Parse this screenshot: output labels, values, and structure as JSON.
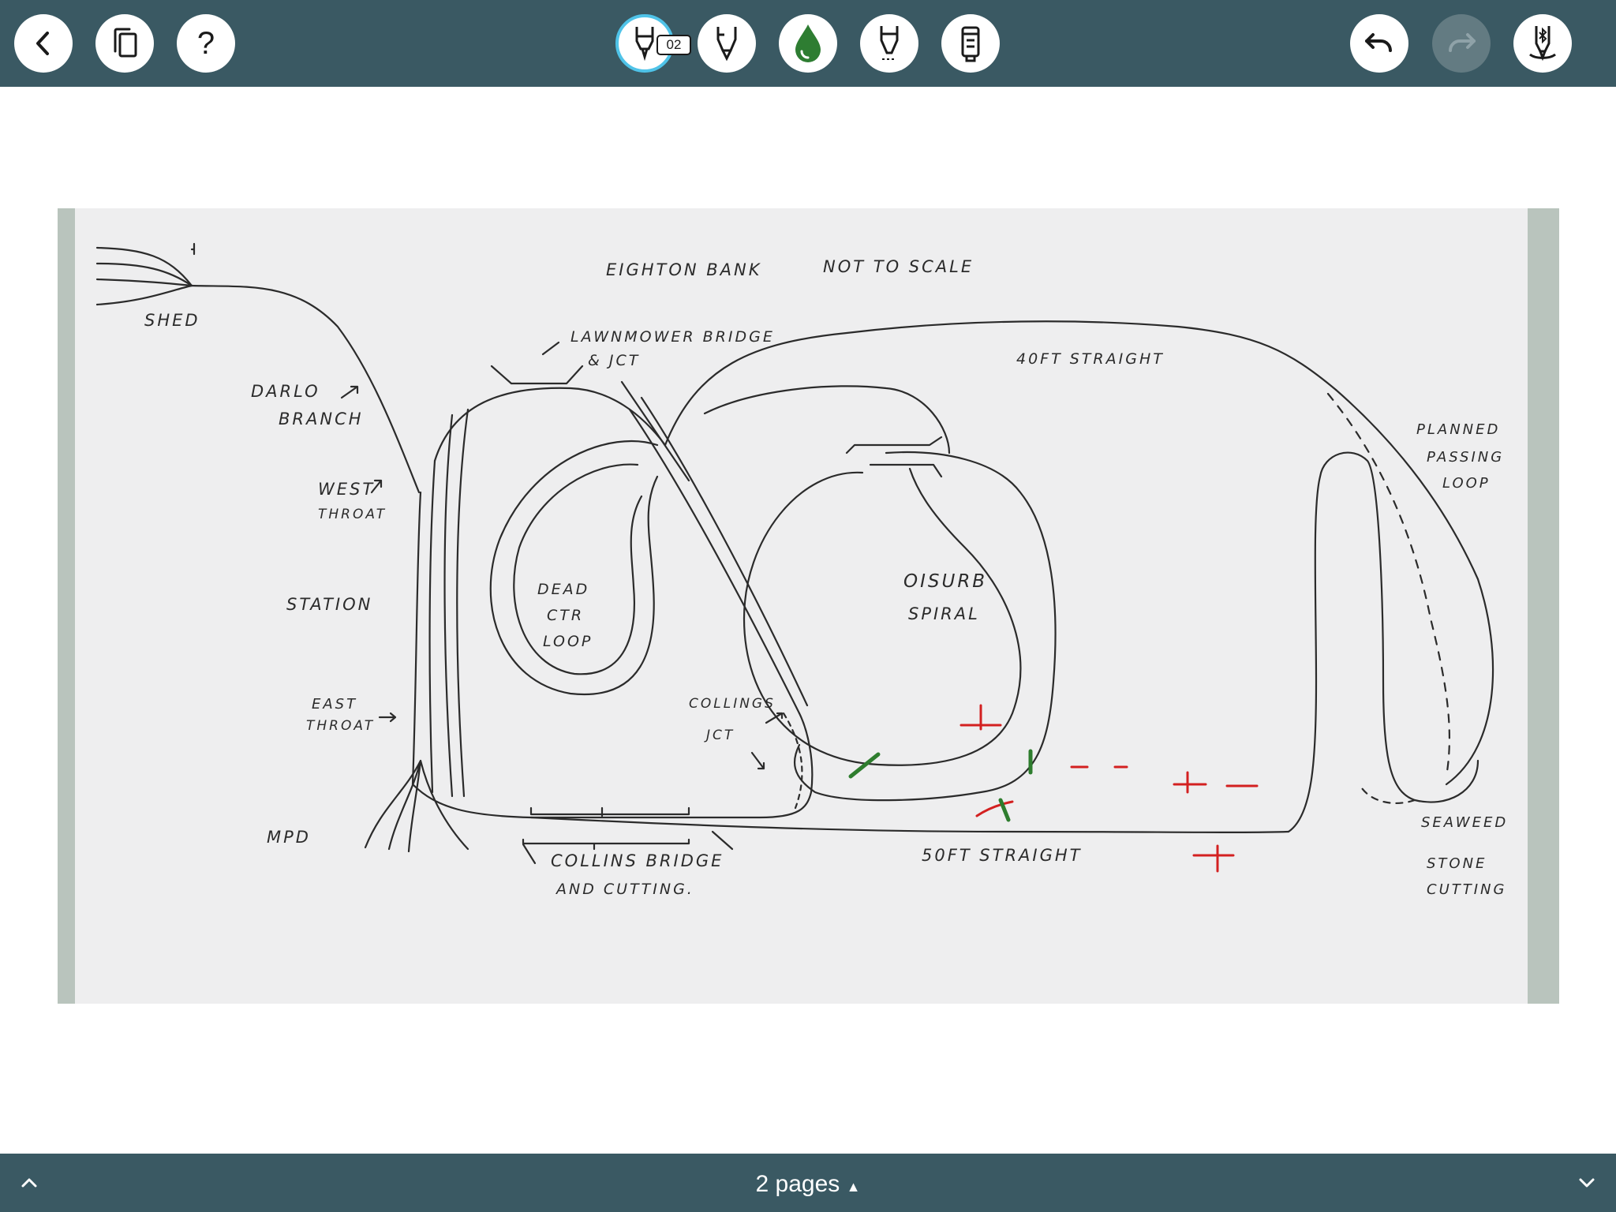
{
  "toolbar": {
    "left_buttons": [
      {
        "id": "back",
        "icon": "chevron-left-icon"
      },
      {
        "id": "pages",
        "icon": "copy-pages-icon"
      },
      {
        "id": "help",
        "icon": "question-mark-icon",
        "label": "?"
      }
    ],
    "tools": [
      {
        "id": "ballpoint-pen",
        "icon": "ballpoint-pen-icon",
        "selected": true,
        "badge": "02"
      },
      {
        "id": "fountain-pen",
        "icon": "fountain-pen-icon"
      },
      {
        "id": "ink-color",
        "icon": "ink-drop-icon",
        "color": "#2e7d32"
      },
      {
        "id": "fineliner",
        "icon": "fineliner-icon"
      },
      {
        "id": "marker",
        "icon": "marker-icon"
      }
    ],
    "right_buttons": [
      {
        "id": "undo",
        "icon": "undo-icon",
        "enabled": true
      },
      {
        "id": "redo",
        "icon": "redo-icon",
        "enabled": false
      },
      {
        "id": "stylus",
        "icon": "bluetooth-stylus-icon"
      }
    ]
  },
  "drawing": {
    "labels": {
      "title": "EIGHTON  BANK",
      "not_to_scale": "NOT TO SCALE",
      "shed": "SHED",
      "darlo_1": "DARLO",
      "darlo_2": "BRANCH",
      "west_1": "WEST",
      "west_2": "THROAT",
      "station": "STATION",
      "east_1": "EAST",
      "east_2": "THROAT",
      "mpd": "MPD",
      "lawnmower_1": "LAWNMOWER BRIDGE",
      "lawnmower_2": "& JCT",
      "loft_straight": "40FT STRAIGHT",
      "planned_1": "PLANNED",
      "planned_2": "PASSING",
      "planned_3": "LOOP",
      "dead_1": "DEAD",
      "dead_2": "CTR",
      "dead_3": "LOOP",
      "oisurb_1": "OISURB",
      "oisurb_2": "SPIRAL",
      "collings_1": "COLLINGS",
      "collings_2": "JCT",
      "collins_bridge_1": "COLLINS BRIDGE",
      "collins_bridge_2": "AND CUTTING.",
      "fifty_straight": "50FT  STRAIGHT",
      "seaweed_1": "SEAWEED",
      "seaweed_2": "STONE",
      "seaweed_3": "CUTTING"
    },
    "annotation_colors": {
      "pencil": "#2b2b2b",
      "red": "#d32020",
      "green": "#2e7d2e"
    }
  },
  "footer": {
    "pages_label": "2 pages",
    "expand_icon": "chevron-up-icon",
    "collapse_icon": "chevron-down-icon"
  }
}
